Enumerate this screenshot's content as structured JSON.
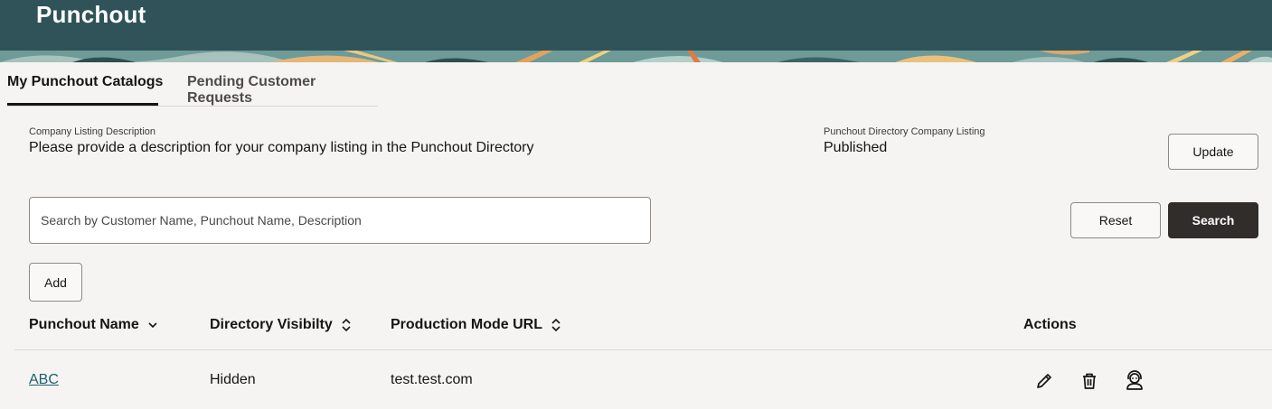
{
  "header": {
    "title": "Punchout"
  },
  "tabs": [
    {
      "label": "My Punchout Catalogs",
      "active": true
    },
    {
      "label": "Pending Customer Requests",
      "active": false
    }
  ],
  "listing": {
    "description_label": "Company Listing Description",
    "description_value": "Please provide a description for your company listing in the Punchout Directory",
    "directory_label": "Punchout Directory Company Listing",
    "directory_value": "Published",
    "update_label": "Update"
  },
  "search": {
    "placeholder": "Search by Customer Name, Punchout Name, Description",
    "value": "",
    "reset_label": "Reset",
    "search_label": "Search"
  },
  "toolbar": {
    "add_label": "Add"
  },
  "table": {
    "columns": [
      {
        "label": "Punchout Name",
        "sort_icon": "chevron-down-icon"
      },
      {
        "label": "Directory Visibilty",
        "sort_icon": "sort-updown-icon"
      },
      {
        "label": "Production Mode URL",
        "sort_icon": "sort-updown-icon"
      },
      {
        "label": "Actions"
      }
    ],
    "rows": [
      {
        "name": "ABC",
        "visibility": "Hidden",
        "url": "test.test.com",
        "actions": [
          "pencil-icon",
          "trash-icon",
          "support-agent-icon"
        ]
      }
    ]
  },
  "colors": {
    "header_bg": "#30535a",
    "primary_button": "#312d2a",
    "link": "#1c5f72",
    "page_bg": "#f5f4f2"
  }
}
